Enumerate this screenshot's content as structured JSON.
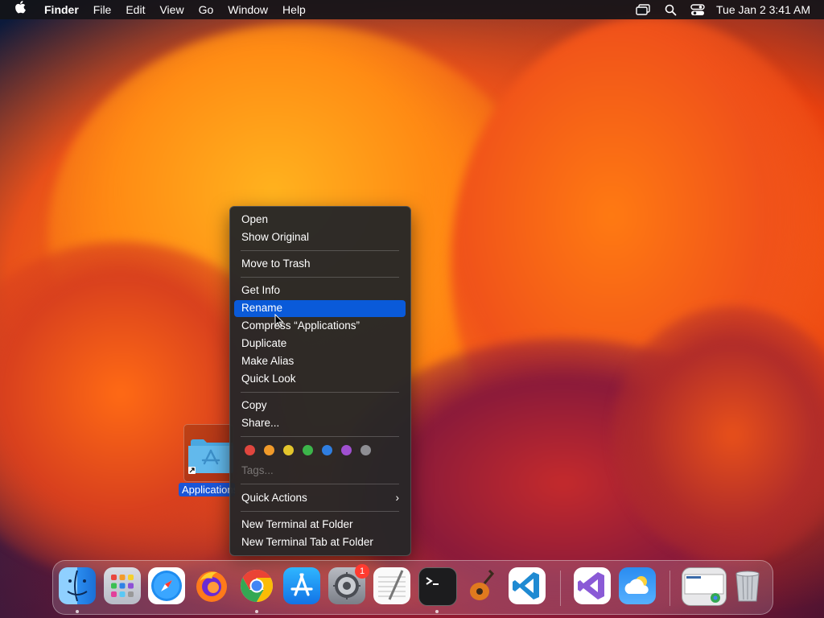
{
  "menubar": {
    "apple": "",
    "app_name": "Finder",
    "items": [
      "File",
      "Edit",
      "View",
      "Go",
      "Window",
      "Help"
    ],
    "clock": "Tue Jan 2  3:41 AM"
  },
  "desktop": {
    "icon_label": "Applications"
  },
  "context_menu": {
    "items": {
      "open": "Open",
      "show_original": "Show Original",
      "move_to_trash": "Move to Trash",
      "get_info": "Get Info",
      "rename": "Rename",
      "compress": "Compress “Applications”",
      "duplicate": "Duplicate",
      "make_alias": "Make Alias",
      "quick_look": "Quick Look",
      "copy": "Copy",
      "share": "Share...",
      "tags": "Tags...",
      "quick_actions": "Quick Actions",
      "new_terminal": "New Terminal at Folder",
      "new_terminal_tab": "New Terminal Tab at Folder"
    },
    "highlighted": "Rename",
    "tag_colors": [
      "#e0463e",
      "#f09a2a",
      "#e3c52c",
      "#3cb54a",
      "#2f7ee0",
      "#a050d0",
      "#8e8e93"
    ],
    "quick_actions_chevron": "›"
  },
  "dock": {
    "apps": [
      "finder-icon",
      "launchpad-icon",
      "safari-icon",
      "firefox-icon",
      "chrome-icon",
      "app-store-icon",
      "system-settings-icon",
      "textedit-icon",
      "terminal-icon",
      "garageband-icon",
      "vscode-icon",
      "visual-studio-icon",
      "weather-icon",
      "window-preview",
      "trash-icon"
    ],
    "settings_badge": "1"
  }
}
